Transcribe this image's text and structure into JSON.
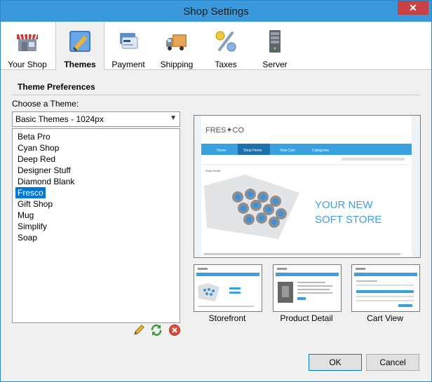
{
  "window": {
    "title": "Shop Settings",
    "close_glyph": "✕"
  },
  "tabs": [
    {
      "label": "Your Shop",
      "icon": "storefront-icon"
    },
    {
      "label": "Themes",
      "icon": "paintbrush-icon"
    },
    {
      "label": "Payment",
      "icon": "credit-card-icon"
    },
    {
      "label": "Shipping",
      "icon": "truck-icon"
    },
    {
      "label": "Taxes",
      "icon": "percent-icon"
    },
    {
      "label": "Server",
      "icon": "server-icon"
    }
  ],
  "section": {
    "title": "Theme Preferences",
    "choose_label": "Choose a Theme:"
  },
  "theme_select": {
    "value": "Basic Themes - 1024px"
  },
  "themes": [
    "Beta Pro",
    "Cyan Shop",
    "Deep Red",
    "Designer Stuff",
    "Diamond Blank",
    "Fresco",
    "Gift Shop",
    "Mug",
    "Simplify",
    "Soap"
  ],
  "selected_theme": "Fresco",
  "preview": {
    "logo": "FRES✦CO",
    "nav": [
      "Home",
      "Shop Home",
      "View Cart",
      "Categories"
    ],
    "breadcrumb": "Shop Home",
    "headline_1": "YOUR NEW",
    "headline_2": "SOFT STORE",
    "accent": "#3aa0e0"
  },
  "thumbnails": [
    "Storefront",
    "Product Detail",
    "Cart View"
  ],
  "buttons": {
    "ok": "OK",
    "cancel": "Cancel"
  }
}
